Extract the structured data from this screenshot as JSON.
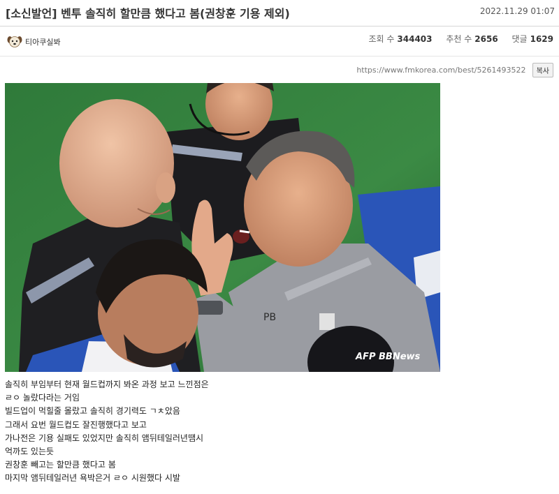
{
  "post": {
    "title": "[소신발언] 벤투 솔직히 할만큼 했다고 봄(권창훈 기용 제외)",
    "date": "2022.11.29 01:07"
  },
  "author": {
    "name": "티아쿠실봐",
    "avatar_icon": "dog-face-icon"
  },
  "stats": {
    "views_label": "조회 수",
    "views": "344403",
    "likes_label": "추천 수",
    "likes": "2656",
    "comments_label": "댓글",
    "comments": "1629"
  },
  "share": {
    "url": "https://www.fmkorea.com/best/5261493522",
    "copy_label": "복사"
  },
  "image": {
    "watermark": "AFP BBNews",
    "shirt_initials": "PB"
  },
  "body": {
    "lines": [
      "솔직히 부임부터 현재 월드컵까지 봐온 과정 보고 느낀점은",
      "ㄹㅇ 놀랐다라는 거임",
      "빌드업이 먹힐줄 몰랐고 솔직히 경기력도 ㄱㅊ았음",
      "그래서 요번 월드컵도 잘진행했다고 보고",
      "가나전은 기용 실패도 있었지만 솔직히 앰뒤테일러년땜시",
      "억까도 있는듯",
      "권창훈 빼고는 할만큼 했다고 봄",
      "마지막 앰뒤테일러년 욕박은거 ㄹㅇ 시원했다 시발"
    ]
  },
  "colors": {
    "pitch": "#2f7a3a",
    "referee_kit": "#1c1c1f",
    "staff_shirt": "#9a9ca2",
    "korea_blue": "#2a55b8"
  }
}
